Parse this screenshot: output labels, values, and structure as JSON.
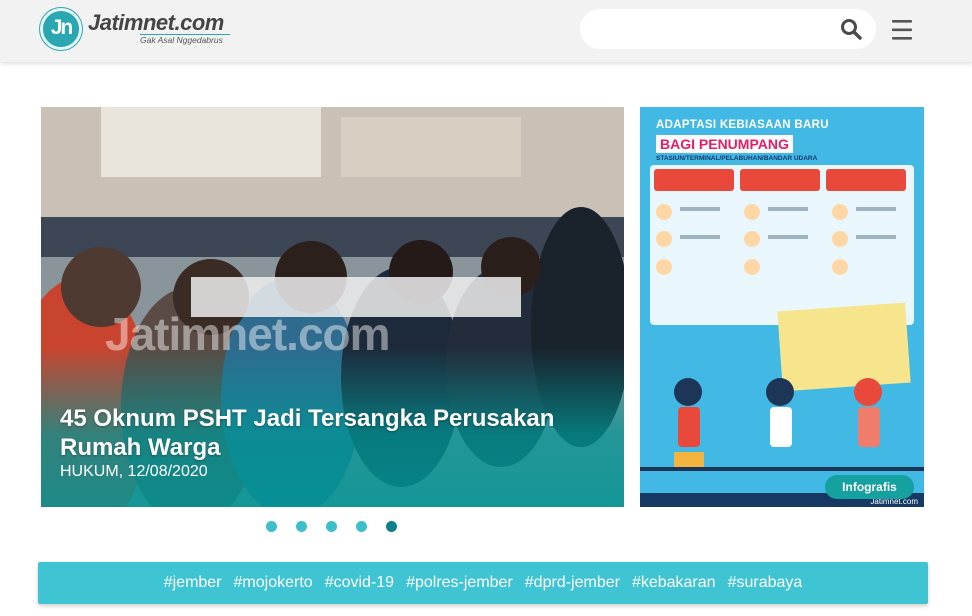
{
  "header": {
    "logo_mark": "Jn",
    "logo_name": "Jatimnet.com",
    "logo_tagline": "Gak Asal Nggedabrus",
    "search_placeholder": "",
    "search_value": ""
  },
  "hero": {
    "title": "45 Oknum PSHT Jadi Tersangka Perusakan Rumah Warga",
    "meta": "HUKUM, 12/08/2020",
    "watermark": "Jatimnet.com"
  },
  "side": {
    "title_line1": "ADAPTASI KEBIASAAN BARU",
    "title_line2": "BAGI PENUMPANG",
    "title_line3": "STASIUN/TERMINAL/PELABUHAN/BANDAR UDARA",
    "footer_brand": "Jatimnet.com",
    "tag": "Infografis"
  },
  "carousel": {
    "count": 5,
    "active_index": 4
  },
  "tags": [
    "#jember",
    "#mojokerto",
    "#covid-19",
    "#polres-jember",
    "#dprd-jember",
    "#kebakaran",
    "#surabaya"
  ],
  "colors": {
    "brand": "#2aa7b2",
    "tagbar": "#3ec4d3",
    "dot": "#3dbfcb",
    "dot_active": "#0e7f8c",
    "infographic_bg": "#41b9e4"
  }
}
